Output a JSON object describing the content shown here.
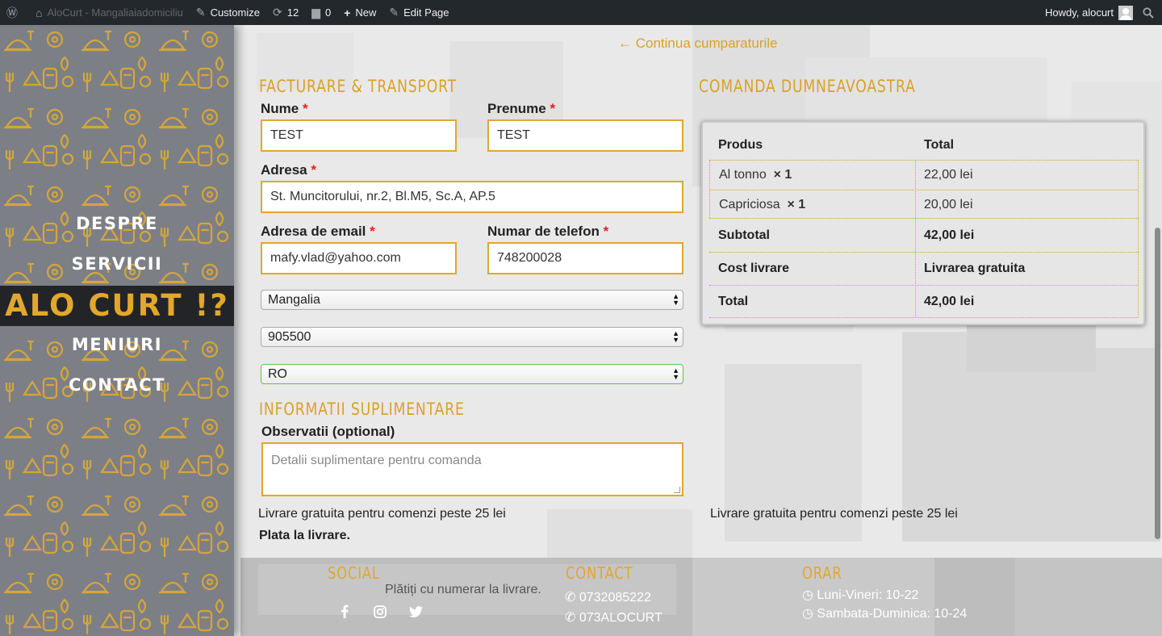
{
  "adminbar": {
    "site_name": "AloCurt - Mangaliaiadomiciliu",
    "customize": "Customize",
    "updates_count": "12",
    "comments_count": "0",
    "new_label": "New",
    "edit_page": "Edit Page",
    "howdy": "Howdy, alocurt"
  },
  "sidebar": {
    "nav": [
      "DESPRE",
      "SERVICII",
      "MENIURI",
      "CONTACT"
    ],
    "brand": "ALO CURT !?"
  },
  "checkout": {
    "continue_link": "← Continua cumparaturile",
    "billing_title": "FACTURARE & TRANSPORT",
    "fields": {
      "nume_label": "Nume",
      "nume_value": "TEST",
      "prenume_label": "Prenume",
      "prenume_value": "TEST",
      "adresa_label": "Adresa",
      "adresa_value": "St. Muncitorului, nr.2, Bl.M5, Sc.A, AP.5",
      "email_label": "Adresa de email",
      "email_value": "mafy.vlad@yahoo.com",
      "phone_label": "Numar de telefon",
      "phone_value": "748200028",
      "city_value": "Mangalia",
      "postcode_value": "905500",
      "country_value": "RO",
      "required_mark": "*"
    },
    "additional_title": "INFORMATII SUPLIMENTARE",
    "notes_label": "Observatii (optional)",
    "notes_placeholder": "Detalii suplimentare pentru comanda",
    "shipping_note": "Livrare gratuita pentru comenzi peste 25 lei",
    "payment_note": "Plata la livrare."
  },
  "order": {
    "title": "COMANDA DUMNEAVOASTRA",
    "col_product": "Produs",
    "col_total": "Total",
    "items": [
      {
        "name": "Al tonno",
        "qty": "× 1",
        "total": "22,00 lei"
      },
      {
        "name": "Capriciosa",
        "qty": "× 1",
        "total": "20,00 lei"
      }
    ],
    "subtotal_label": "Subtotal",
    "subtotal_value": "42,00 lei",
    "shipping_label": "Cost livrare",
    "shipping_value": "Livrarea gratuita",
    "total_label": "Total",
    "total_value": "42,00 lei",
    "shipping_note": "Livrare gratuita pentru comenzi peste 25 lei"
  },
  "footer": {
    "social_title": "SOCIAL",
    "contact_title": "CONTACT",
    "orar_title": "ORAR",
    "pay_text": "Plătiți cu numerar la livrare.",
    "phone1": "0732085222",
    "phone2": "073ALOCURT",
    "hours1": "Luni-Vineri: 10-22",
    "hours2": "Sambata-Duminica: 10-24"
  },
  "colors": {
    "accent": "#e2a72c",
    "admin_bar": "#23282d",
    "sidebar": "#7d7f86",
    "brand_band": "#222427"
  }
}
